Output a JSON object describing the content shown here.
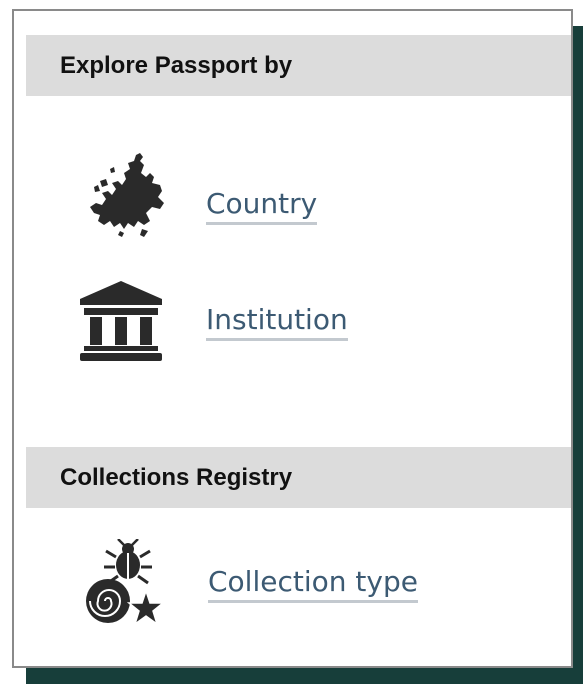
{
  "explore": {
    "heading": "Explore Passport by",
    "items": [
      {
        "label": "Country",
        "icon": "europe-map-icon"
      },
      {
        "label": "Institution",
        "icon": "institution-building-icon"
      }
    ]
  },
  "collections": {
    "heading": "Collections Registry",
    "items": [
      {
        "label": "Collection type",
        "icon": "collection-type-icon"
      }
    ]
  },
  "colors": {
    "header_bg": "#dcdcdc",
    "link": "#3c5a73",
    "link_underline": "#c3c9cf",
    "shadow": "#173e3a",
    "border": "#8a8a8a"
  }
}
